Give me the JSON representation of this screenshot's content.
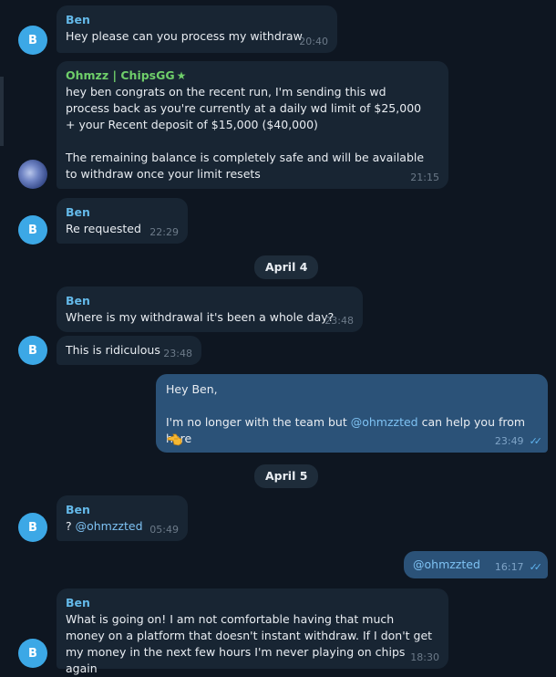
{
  "dates": {
    "d1": "April 4",
    "d2": "April 5"
  },
  "avatars": {
    "ben": "B"
  },
  "messages": {
    "m1": {
      "sender": "Ben",
      "text": "Hey please can you process my withdraw",
      "time": "20:40"
    },
    "m2": {
      "sender": "Ohmzz | ChipsGG",
      "badge_icon": "star-icon",
      "text": "hey ben congrats on the recent run, I'm sending this wd process back as you're currently at a daily wd limit of $25,000 + your Recent deposit of $15,000 ($40,000)\n\nThe remaining balance is completely safe and will be available to withdraw once your limit resets",
      "time": "21:15"
    },
    "m3": {
      "sender": "Ben",
      "text": "Re requested",
      "time": "22:29"
    },
    "m4": {
      "sender": "Ben",
      "text": "Where is my withdrawal it's been a whole day?",
      "time": "23:48"
    },
    "m5": {
      "text": "This is ridiculous",
      "time": "23:48"
    },
    "m6": {
      "line1": "Hey Ben,",
      "line2_pre": "I'm no longer with the team but ",
      "mention": "@ohmzzted",
      "line2_post": " can help you from here",
      "emoji_icon": "pointing-hand-icon",
      "time": "23:49"
    },
    "m7": {
      "sender": "Ben",
      "prefix": "? ",
      "mention": "@ohmzzted",
      "time": "05:49"
    },
    "m8": {
      "mention": "@ohmzzted",
      "time": "16:17"
    },
    "m9": {
      "sender": "Ben",
      "text": "What is going on! I am not comfortable having that much money on a platform that doesn't instant withdraw. If I don't get my money in the next few hours I'm never playing on chips again",
      "time": "18:30"
    }
  },
  "colors": {
    "background": "#0e1621",
    "incoming": "#182533",
    "outgoing": "#2b5278",
    "sender_blue": "#64b9e9",
    "sender_green": "#6fcf6a",
    "avatar": "#3ca8e6"
  }
}
